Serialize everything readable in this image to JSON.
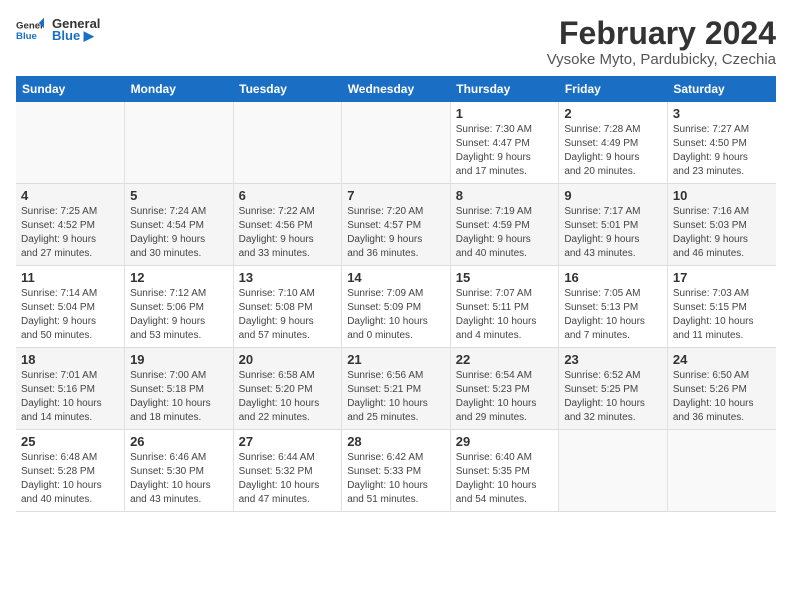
{
  "logo": {
    "line1": "General",
    "line2": "Blue"
  },
  "title": "February 2024",
  "subtitle": "Vysoke Myto, Pardubicky, Czechia",
  "weekdays": [
    "Sunday",
    "Monday",
    "Tuesday",
    "Wednesday",
    "Thursday",
    "Friday",
    "Saturday"
  ],
  "weeks": [
    [
      {
        "day": "",
        "info": ""
      },
      {
        "day": "",
        "info": ""
      },
      {
        "day": "",
        "info": ""
      },
      {
        "day": "",
        "info": ""
      },
      {
        "day": "1",
        "info": "Sunrise: 7:30 AM\nSunset: 4:47 PM\nDaylight: 9 hours\nand 17 minutes."
      },
      {
        "day": "2",
        "info": "Sunrise: 7:28 AM\nSunset: 4:49 PM\nDaylight: 9 hours\nand 20 minutes."
      },
      {
        "day": "3",
        "info": "Sunrise: 7:27 AM\nSunset: 4:50 PM\nDaylight: 9 hours\nand 23 minutes."
      }
    ],
    [
      {
        "day": "4",
        "info": "Sunrise: 7:25 AM\nSunset: 4:52 PM\nDaylight: 9 hours\nand 27 minutes."
      },
      {
        "day": "5",
        "info": "Sunrise: 7:24 AM\nSunset: 4:54 PM\nDaylight: 9 hours\nand 30 minutes."
      },
      {
        "day": "6",
        "info": "Sunrise: 7:22 AM\nSunset: 4:56 PM\nDaylight: 9 hours\nand 33 minutes."
      },
      {
        "day": "7",
        "info": "Sunrise: 7:20 AM\nSunset: 4:57 PM\nDaylight: 9 hours\nand 36 minutes."
      },
      {
        "day": "8",
        "info": "Sunrise: 7:19 AM\nSunset: 4:59 PM\nDaylight: 9 hours\nand 40 minutes."
      },
      {
        "day": "9",
        "info": "Sunrise: 7:17 AM\nSunset: 5:01 PM\nDaylight: 9 hours\nand 43 minutes."
      },
      {
        "day": "10",
        "info": "Sunrise: 7:16 AM\nSunset: 5:03 PM\nDaylight: 9 hours\nand 46 minutes."
      }
    ],
    [
      {
        "day": "11",
        "info": "Sunrise: 7:14 AM\nSunset: 5:04 PM\nDaylight: 9 hours\nand 50 minutes."
      },
      {
        "day": "12",
        "info": "Sunrise: 7:12 AM\nSunset: 5:06 PM\nDaylight: 9 hours\nand 53 minutes."
      },
      {
        "day": "13",
        "info": "Sunrise: 7:10 AM\nSunset: 5:08 PM\nDaylight: 9 hours\nand 57 minutes."
      },
      {
        "day": "14",
        "info": "Sunrise: 7:09 AM\nSunset: 5:09 PM\nDaylight: 10 hours\nand 0 minutes."
      },
      {
        "day": "15",
        "info": "Sunrise: 7:07 AM\nSunset: 5:11 PM\nDaylight: 10 hours\nand 4 minutes."
      },
      {
        "day": "16",
        "info": "Sunrise: 7:05 AM\nSunset: 5:13 PM\nDaylight: 10 hours\nand 7 minutes."
      },
      {
        "day": "17",
        "info": "Sunrise: 7:03 AM\nSunset: 5:15 PM\nDaylight: 10 hours\nand 11 minutes."
      }
    ],
    [
      {
        "day": "18",
        "info": "Sunrise: 7:01 AM\nSunset: 5:16 PM\nDaylight: 10 hours\nand 14 minutes."
      },
      {
        "day": "19",
        "info": "Sunrise: 7:00 AM\nSunset: 5:18 PM\nDaylight: 10 hours\nand 18 minutes."
      },
      {
        "day": "20",
        "info": "Sunrise: 6:58 AM\nSunset: 5:20 PM\nDaylight: 10 hours\nand 22 minutes."
      },
      {
        "day": "21",
        "info": "Sunrise: 6:56 AM\nSunset: 5:21 PM\nDaylight: 10 hours\nand 25 minutes."
      },
      {
        "day": "22",
        "info": "Sunrise: 6:54 AM\nSunset: 5:23 PM\nDaylight: 10 hours\nand 29 minutes."
      },
      {
        "day": "23",
        "info": "Sunrise: 6:52 AM\nSunset: 5:25 PM\nDaylight: 10 hours\nand 32 minutes."
      },
      {
        "day": "24",
        "info": "Sunrise: 6:50 AM\nSunset: 5:26 PM\nDaylight: 10 hours\nand 36 minutes."
      }
    ],
    [
      {
        "day": "25",
        "info": "Sunrise: 6:48 AM\nSunset: 5:28 PM\nDaylight: 10 hours\nand 40 minutes."
      },
      {
        "day": "26",
        "info": "Sunrise: 6:46 AM\nSunset: 5:30 PM\nDaylight: 10 hours\nand 43 minutes."
      },
      {
        "day": "27",
        "info": "Sunrise: 6:44 AM\nSunset: 5:32 PM\nDaylight: 10 hours\nand 47 minutes."
      },
      {
        "day": "28",
        "info": "Sunrise: 6:42 AM\nSunset: 5:33 PM\nDaylight: 10 hours\nand 51 minutes."
      },
      {
        "day": "29",
        "info": "Sunrise: 6:40 AM\nSunset: 5:35 PM\nDaylight: 10 hours\nand 54 minutes."
      },
      {
        "day": "",
        "info": ""
      },
      {
        "day": "",
        "info": ""
      }
    ]
  ]
}
